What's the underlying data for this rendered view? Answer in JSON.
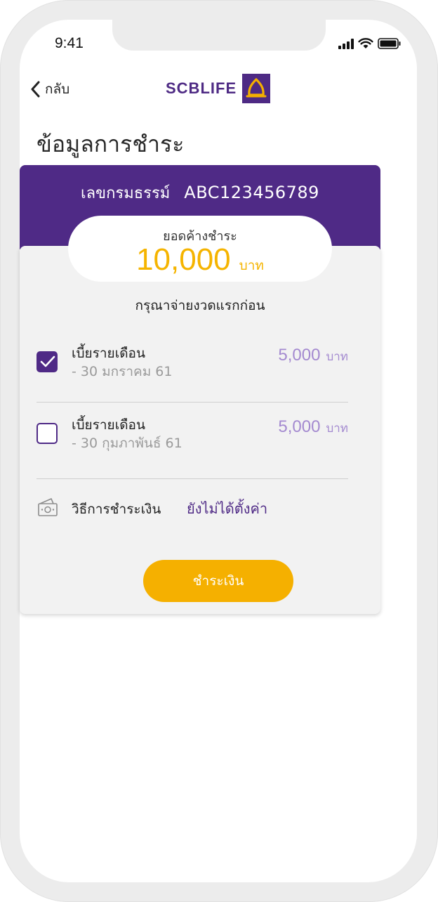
{
  "status_bar": {
    "time": "9:41"
  },
  "nav": {
    "back_label": "กลับ",
    "logo_text": "SCBLIFE"
  },
  "page": {
    "title": "ข้อมูลการชำระ"
  },
  "policy": {
    "label": "เลขกรมธรรม์",
    "number": "ABC123456789"
  },
  "outstanding": {
    "label": "ยอดค้างชำระ",
    "amount": "10,000",
    "unit": "บาท"
  },
  "notice": "กรุณาจ่ายงวดแรกก่อน",
  "installments": [
    {
      "title": "เบี้ยรายเดือน",
      "date": "- 30 มกราคม 61",
      "amount": "5,000",
      "unit": "บาท",
      "checked": true
    },
    {
      "title": "เบี้ยรายเดือน",
      "date": "- 30 กุมภาพันธ์ 61",
      "amount": "5,000",
      "unit": "บาท",
      "checked": false
    }
  ],
  "payment_method": {
    "label": "วิธีการชำระเงิน",
    "value": "ยังไม่ได้ตั้งค่า",
    "icon": "money-icon"
  },
  "pay_button": {
    "label": "ชำระเงิน"
  },
  "colors": {
    "brand_purple": "#4f2a86",
    "accent_yellow": "#f5b000",
    "amount_lilac": "#a48ad0"
  }
}
